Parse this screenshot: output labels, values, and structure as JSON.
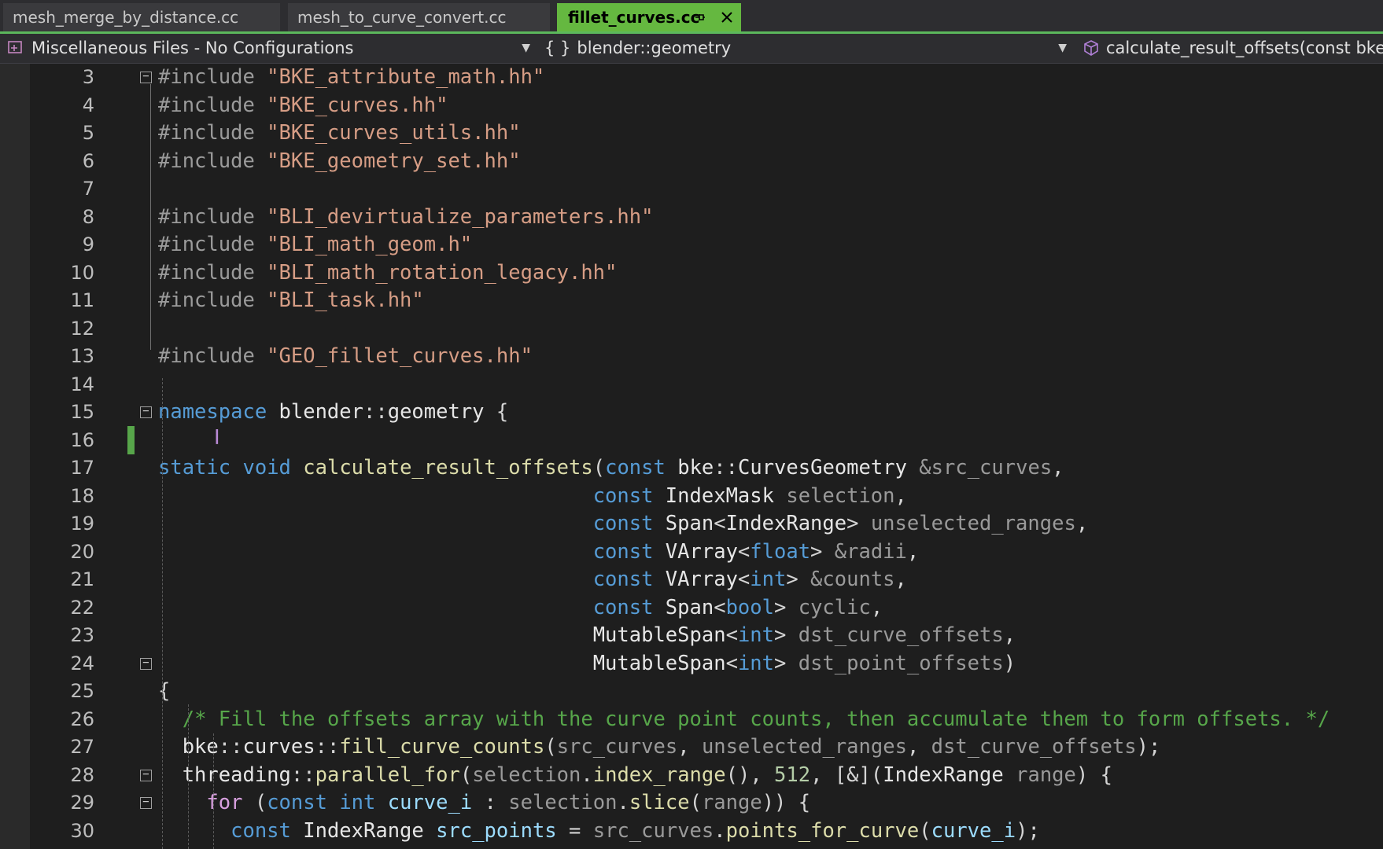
{
  "tabs": [
    {
      "label": "mesh_merge_by_distance.cc",
      "active": false
    },
    {
      "label": "mesh_to_curve_convert.cc",
      "active": false
    },
    {
      "label": "fillet_curves.cc",
      "active": true
    }
  ],
  "navbar": {
    "project": "Miscellaneous Files - No Configurations",
    "scope": "blender::geometry",
    "member": "calculate_result_offsets(const bke::CurvesGeometry &src_curves, const IndexMask selection, ...)"
  },
  "colors": {
    "accent": "#65b840",
    "keyword": "#569cd6",
    "string": "#d69d85",
    "function": "#dcdcaa",
    "comment": "#57a64a",
    "control": "#d8a0df",
    "number": "#b5cea8",
    "variable": "#9cdcfe"
  },
  "icons": {
    "project": "project-file-icon",
    "scope": "namespace-braces-icon",
    "member": "method-cube-icon",
    "pin": "pin-icon",
    "close": "close-icon",
    "fold": "collapse-minus-icon"
  },
  "lines": [
    {
      "n": "3",
      "fold": true,
      "tokens": [
        [
          "#include ",
          "pp"
        ],
        [
          "\"BKE_attribute_math.hh\"",
          "str"
        ]
      ]
    },
    {
      "n": "4",
      "tokens": [
        [
          "#include ",
          "pp"
        ],
        [
          "\"BKE_curves.hh\"",
          "str"
        ]
      ]
    },
    {
      "n": "5",
      "tokens": [
        [
          "#include ",
          "pp"
        ],
        [
          "\"BKE_curves_utils.hh\"",
          "str"
        ]
      ]
    },
    {
      "n": "6",
      "tokens": [
        [
          "#include ",
          "pp"
        ],
        [
          "\"BKE_geometry_set.hh\"",
          "str"
        ]
      ]
    },
    {
      "n": "7",
      "tokens": []
    },
    {
      "n": "8",
      "tokens": [
        [
          "#include ",
          "pp"
        ],
        [
          "\"BLI_devirtualize_parameters.hh\"",
          "str"
        ]
      ]
    },
    {
      "n": "9",
      "tokens": [
        [
          "#include ",
          "pp"
        ],
        [
          "\"BLI_math_geom.h\"",
          "str"
        ]
      ]
    },
    {
      "n": "10",
      "tokens": [
        [
          "#include ",
          "pp"
        ],
        [
          "\"BLI_math_rotation_legacy.hh\"",
          "str"
        ]
      ]
    },
    {
      "n": "11",
      "tokens": [
        [
          "#include ",
          "pp"
        ],
        [
          "\"BLI_task.hh\"",
          "str"
        ]
      ]
    },
    {
      "n": "12",
      "tokens": []
    },
    {
      "n": "13",
      "tokens": [
        [
          "#include ",
          "pp"
        ],
        [
          "\"GEO_fillet_curves.hh\"",
          "str"
        ]
      ]
    },
    {
      "n": "14",
      "tokens": []
    },
    {
      "n": "15",
      "fold": true,
      "tokens": [
        [
          "namespace",
          "kw"
        ],
        [
          " blender",
          "tyw"
        ],
        [
          "::",
          "pun"
        ],
        [
          "geometry ",
          "tyw"
        ],
        [
          "{",
          "pun"
        ]
      ]
    },
    {
      "n": "16",
      "tokens": []
    },
    {
      "n": "17",
      "tokens": [
        [
          "static",
          "kw"
        ],
        [
          " ",
          "pun"
        ],
        [
          "void",
          "kw"
        ],
        [
          " ",
          "pun"
        ],
        [
          "calculate_result_offsets",
          "fn"
        ],
        [
          "(",
          "pun"
        ],
        [
          "const",
          "kw"
        ],
        [
          " bke",
          "tyw"
        ],
        [
          "::",
          "pun"
        ],
        [
          "CurvesGeometry",
          "tyw"
        ],
        [
          " &src_curves",
          "prm"
        ],
        [
          ",",
          "pun"
        ]
      ]
    },
    {
      "n": "18",
      "tokens": [
        [
          "                                    ",
          "pun"
        ],
        [
          "const",
          "kw"
        ],
        [
          " IndexMask",
          "tyw"
        ],
        [
          " selection",
          "prm"
        ],
        [
          ",",
          "pun"
        ]
      ]
    },
    {
      "n": "19",
      "tokens": [
        [
          "                                    ",
          "pun"
        ],
        [
          "const",
          "kw"
        ],
        [
          " Span",
          "tyw"
        ],
        [
          "<",
          "pun"
        ],
        [
          "IndexRange",
          "tyw"
        ],
        [
          ">",
          "pun"
        ],
        [
          " unselected_ranges",
          "prm"
        ],
        [
          ",",
          "pun"
        ]
      ]
    },
    {
      "n": "20",
      "tokens": [
        [
          "                                    ",
          "pun"
        ],
        [
          "const",
          "kw"
        ],
        [
          " VArray",
          "tyw"
        ],
        [
          "<",
          "pun"
        ],
        [
          "float",
          "kw"
        ],
        [
          ">",
          "pun"
        ],
        [
          " &radii",
          "prm"
        ],
        [
          ",",
          "pun"
        ]
      ]
    },
    {
      "n": "21",
      "tokens": [
        [
          "                                    ",
          "pun"
        ],
        [
          "const",
          "kw"
        ],
        [
          " VArray",
          "tyw"
        ],
        [
          "<",
          "pun"
        ],
        [
          "int",
          "kw"
        ],
        [
          ">",
          "pun"
        ],
        [
          " &counts",
          "prm"
        ],
        [
          ",",
          "pun"
        ]
      ]
    },
    {
      "n": "22",
      "tokens": [
        [
          "                                    ",
          "pun"
        ],
        [
          "const",
          "kw"
        ],
        [
          " Span",
          "tyw"
        ],
        [
          "<",
          "pun"
        ],
        [
          "bool",
          "kw"
        ],
        [
          ">",
          "pun"
        ],
        [
          " cyclic",
          "prm"
        ],
        [
          ",",
          "pun"
        ]
      ]
    },
    {
      "n": "23",
      "tokens": [
        [
          "                                    ",
          "pun"
        ],
        [
          "MutableSpan",
          "tyw"
        ],
        [
          "<",
          "pun"
        ],
        [
          "int",
          "kw"
        ],
        [
          ">",
          "pun"
        ],
        [
          " dst_curve_offsets",
          "prm"
        ],
        [
          ",",
          "pun"
        ]
      ]
    },
    {
      "n": "24",
      "fold": true,
      "tokens": [
        [
          "                                    ",
          "pun"
        ],
        [
          "MutableSpan",
          "tyw"
        ],
        [
          "<",
          "pun"
        ],
        [
          "int",
          "kw"
        ],
        [
          ">",
          "pun"
        ],
        [
          " dst_point_offsets",
          "prm"
        ],
        [
          ")",
          "pun"
        ]
      ]
    },
    {
      "n": "25",
      "tokens": [
        [
          "{",
          "pun"
        ]
      ]
    },
    {
      "n": "26",
      "tokens": [
        [
          "  ",
          "pun"
        ],
        [
          "/* Fill the offsets array with the curve point counts, then accumulate them to form offsets. */",
          "cm"
        ]
      ]
    },
    {
      "n": "27",
      "tokens": [
        [
          "  bke",
          "tyw"
        ],
        [
          "::",
          "pun"
        ],
        [
          "curves",
          "tyw"
        ],
        [
          "::",
          "pun"
        ],
        [
          "fill_curve_counts",
          "fn"
        ],
        [
          "(",
          "pun"
        ],
        [
          "src_curves",
          "prm"
        ],
        [
          ", ",
          "pun"
        ],
        [
          "unselected_ranges",
          "prm"
        ],
        [
          ", ",
          "pun"
        ],
        [
          "dst_curve_offsets",
          "prm"
        ],
        [
          ");",
          "pun"
        ]
      ]
    },
    {
      "n": "28",
      "fold": true,
      "tokens": [
        [
          "  threading",
          "tyw"
        ],
        [
          "::",
          "pun"
        ],
        [
          "parallel_for",
          "fn"
        ],
        [
          "(",
          "pun"
        ],
        [
          "selection",
          "prm"
        ],
        [
          ".",
          "pun"
        ],
        [
          "index_range",
          "fn"
        ],
        [
          "(), ",
          "pun"
        ],
        [
          "512",
          "num"
        ],
        [
          ", [&](",
          "pun"
        ],
        [
          "IndexRange",
          "tyw"
        ],
        [
          " range",
          "prm"
        ],
        [
          ") {",
          "pun"
        ]
      ]
    },
    {
      "n": "29",
      "fold": true,
      "tokens": [
        [
          "    ",
          "pun"
        ],
        [
          "for",
          "ctl"
        ],
        [
          " (",
          "pun"
        ],
        [
          "const",
          "kw"
        ],
        [
          " ",
          "pun"
        ],
        [
          "int",
          "kw"
        ],
        [
          " ",
          "pun"
        ],
        [
          "curve_i",
          "var"
        ],
        [
          " : ",
          "pun"
        ],
        [
          "selection",
          "prm"
        ],
        [
          ".",
          "pun"
        ],
        [
          "slice",
          "fn"
        ],
        [
          "(",
          "pun"
        ],
        [
          "range",
          "prm"
        ],
        [
          ")) {",
          "pun"
        ]
      ]
    },
    {
      "n": "30",
      "tokens": [
        [
          "      ",
          "pun"
        ],
        [
          "const",
          "kw"
        ],
        [
          " IndexRange",
          "tyw"
        ],
        [
          " ",
          "pun"
        ],
        [
          "src_points",
          "var"
        ],
        [
          " = ",
          "pun"
        ],
        [
          "src_curves",
          "prm"
        ],
        [
          ".",
          "pun"
        ],
        [
          "points_for_curve",
          "fn"
        ],
        [
          "(",
          "pun"
        ],
        [
          "curve_i",
          "var"
        ],
        [
          ");",
          "pun"
        ]
      ]
    }
  ]
}
